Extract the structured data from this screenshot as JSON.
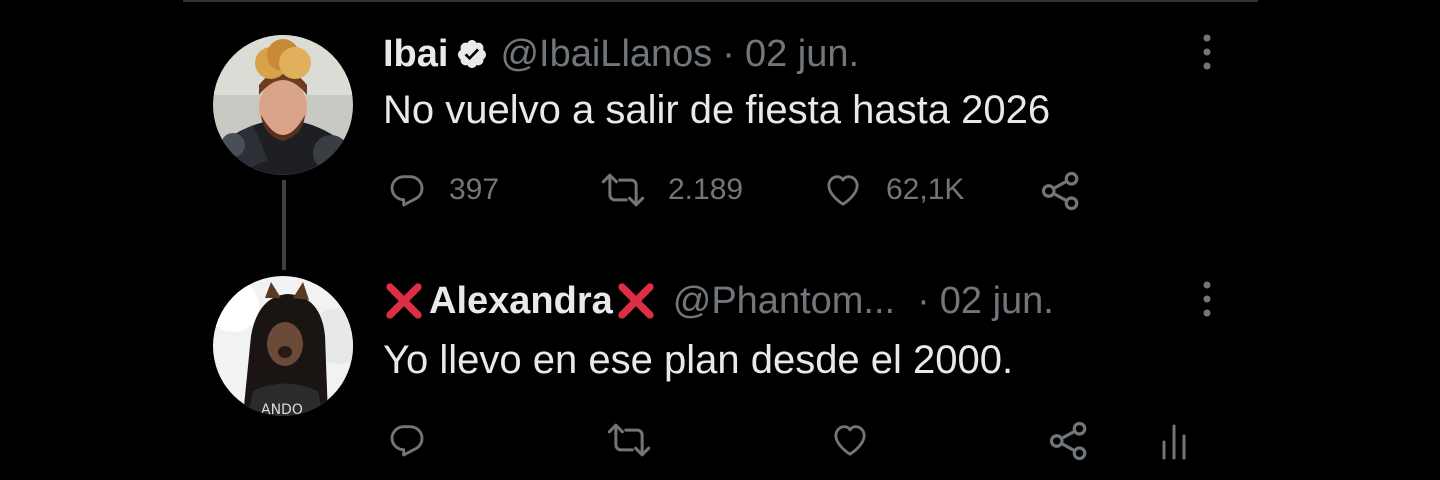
{
  "tweet1": {
    "name": "Ibai",
    "handle": "@IbaiLlanos",
    "separator": "·",
    "date": "02 jun.",
    "text": "No vuelvo a salir de fiesta hasta 2026",
    "replies": "397",
    "retweets": "2.189",
    "likes": "62,1K",
    "icons": [
      "verified-icon",
      "more-icon",
      "reply-icon",
      "retweet-icon",
      "like-icon",
      "share-icon"
    ]
  },
  "tweet2": {
    "name": "Alexandra",
    "handle": "@Phantom...",
    "separator": "·",
    "date": "02 jun.",
    "text": "Yo llevo en ese plan desde el 2000.",
    "icons": [
      "cross-emoji-icon",
      "more-icon",
      "reply-icon",
      "retweet-icon",
      "like-icon",
      "share-icon",
      "analytics-icon"
    ]
  },
  "colors": {
    "background": "#000000",
    "text_primary": "#e7e9ea",
    "text_secondary": "#71767b",
    "verified_badge": "#e7e9ea",
    "cross_emoji": "#dd2e44",
    "thread_line": "#3e4144"
  }
}
